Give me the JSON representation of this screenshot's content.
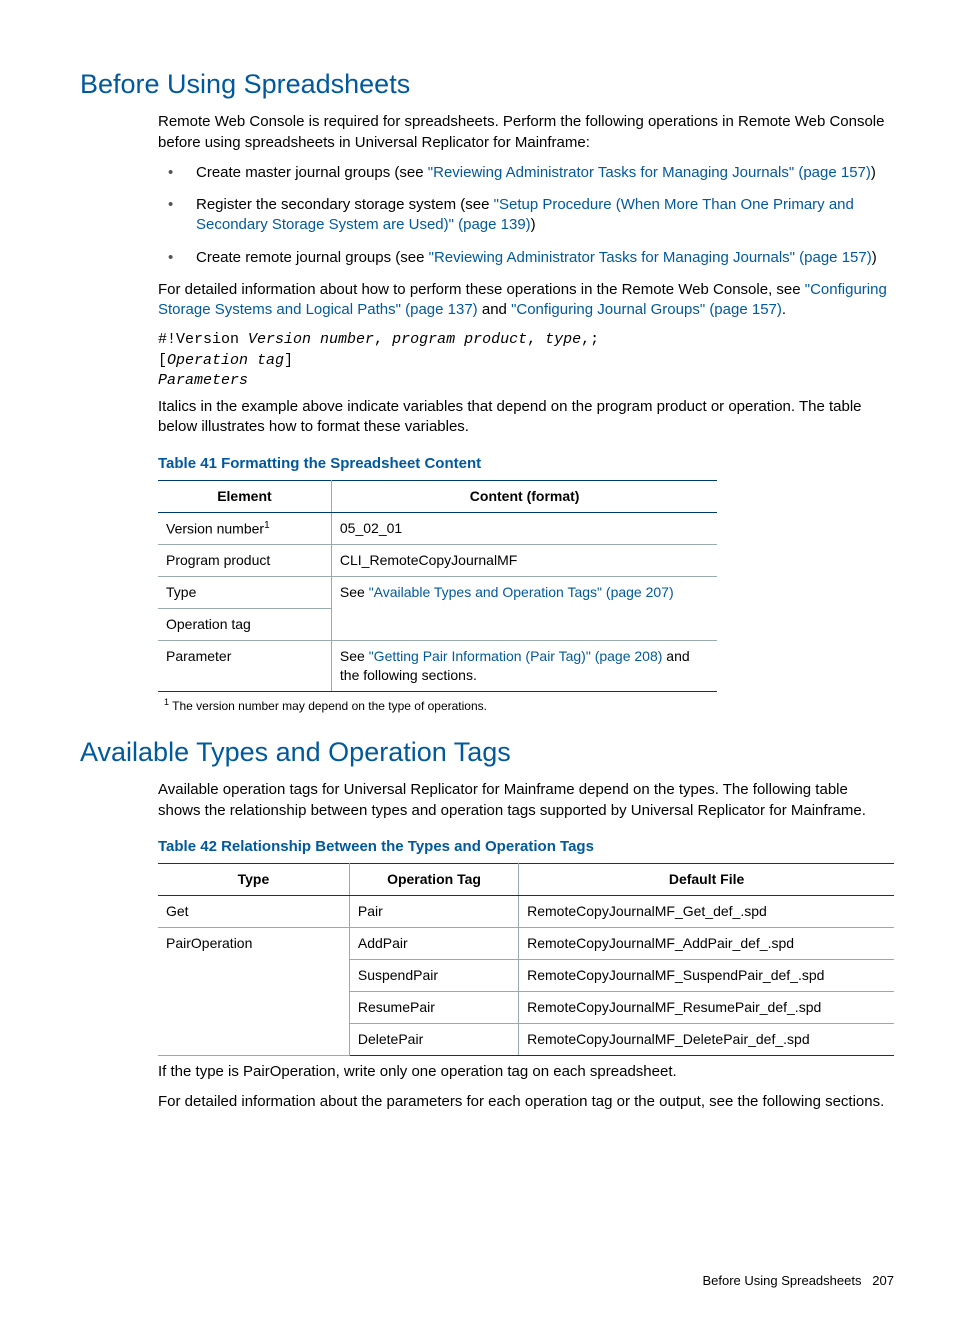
{
  "section1": {
    "title": "Before Using Spreadsheets",
    "intro": "Remote Web Console is required for spreadsheets. Perform the following operations in Remote Web Console before using spreadsheets in Universal Replicator for Mainframe:",
    "bullets": [
      {
        "pre": "Create master journal groups (see ",
        "link": "\"Reviewing Administrator Tasks for Managing Journals\" (page 157)",
        "post": ")"
      },
      {
        "pre": "Register the secondary storage system (see ",
        "link": "\"Setup Procedure (When More Than One Primary and Secondary Storage System are Used)\" (page 139)",
        "post": ")"
      },
      {
        "pre": "Create remote journal groups (see ",
        "link": "\"Reviewing Administrator Tasks for Managing Journals\" (page 157)",
        "post": ")"
      }
    ],
    "detail_pre": "For detailed information about how to perform these operations in the Remote Web Console, see ",
    "detail_link1": "\"Configuring Storage Systems and Logical Paths\" (page 137)",
    "detail_mid": " and ",
    "detail_link2": "\"Configuring Journal Groups\" (page 157)",
    "detail_post": ".",
    "code_l1a": "#!Version ",
    "code_l1b": "Version number",
    "code_l1c": ", ",
    "code_l1d": "program product",
    "code_l1e": ", ",
    "code_l1f": "type",
    "code_l1g": ",;",
    "code_l2a": "[",
    "code_l2b": "Operation tag",
    "code_l2c": "]",
    "code_l3": "Parameters",
    "after_code": "Italics in the example above indicate variables that depend on the program product or operation. The table below illustrates how to format these variables.",
    "table_caption": "Table 41 Formatting the Spreadsheet Content",
    "t41_h1": "Element",
    "t41_h2": "Content (format)",
    "t41": {
      "r1c1": "Version number",
      "r1c1_sup": "1",
      "r1c2": "05_02_01",
      "r2c1": "Program product",
      "r2c2": "CLI_RemoteCopyJournalMF",
      "r3c1": "Type",
      "r3c2_pre": "See ",
      "r3c2_link": "\"Available Types and Operation Tags\" (page 207)",
      "r4c1": "Operation tag",
      "r5c1": "Parameter",
      "r5c2_pre": "See ",
      "r5c2_link": "\"Getting Pair Information (Pair Tag)\" (page 208)",
      "r5c2_post": " and the following sections."
    },
    "footnote_sup": "1",
    "footnote": "  The version number may depend on the type of operations."
  },
  "section2": {
    "title": "Available Types and Operation Tags",
    "intro": "Available operation tags for Universal Replicator for Mainframe depend on the types. The following table shows the relationship between types and operation tags supported by Universal Replicator for Mainframe.",
    "table_caption": "Table 42 Relationship Between the Types and Operation Tags",
    "t42_h1": "Type",
    "t42_h2": "Operation Tag",
    "t42_h3": "Default File",
    "t42": {
      "r1": {
        "c1": "Get",
        "c2": "Pair",
        "c3": "RemoteCopyJournalMF_Get_def_.spd"
      },
      "r2": {
        "c1": "PairOperation",
        "c2": "AddPair",
        "c3": "RemoteCopyJournalMF_AddPair_def_.spd"
      },
      "r3": {
        "c2": "SuspendPair",
        "c3": "RemoteCopyJournalMF_SuspendPair_def_.spd"
      },
      "r4": {
        "c2": "ResumePair",
        "c3": "RemoteCopyJournalMF_ResumePair_def_.spd"
      },
      "r5": {
        "c2": "DeletePair",
        "c3": "RemoteCopyJournalMF_DeletePair_def_.spd"
      }
    },
    "after1": "If the type is PairOperation, write only one operation tag on each spreadsheet.",
    "after2": "For detailed information about the parameters for each operation tag or the output, see the following sections."
  },
  "footer": {
    "text": "Before Using Spreadsheets",
    "page": "207"
  }
}
